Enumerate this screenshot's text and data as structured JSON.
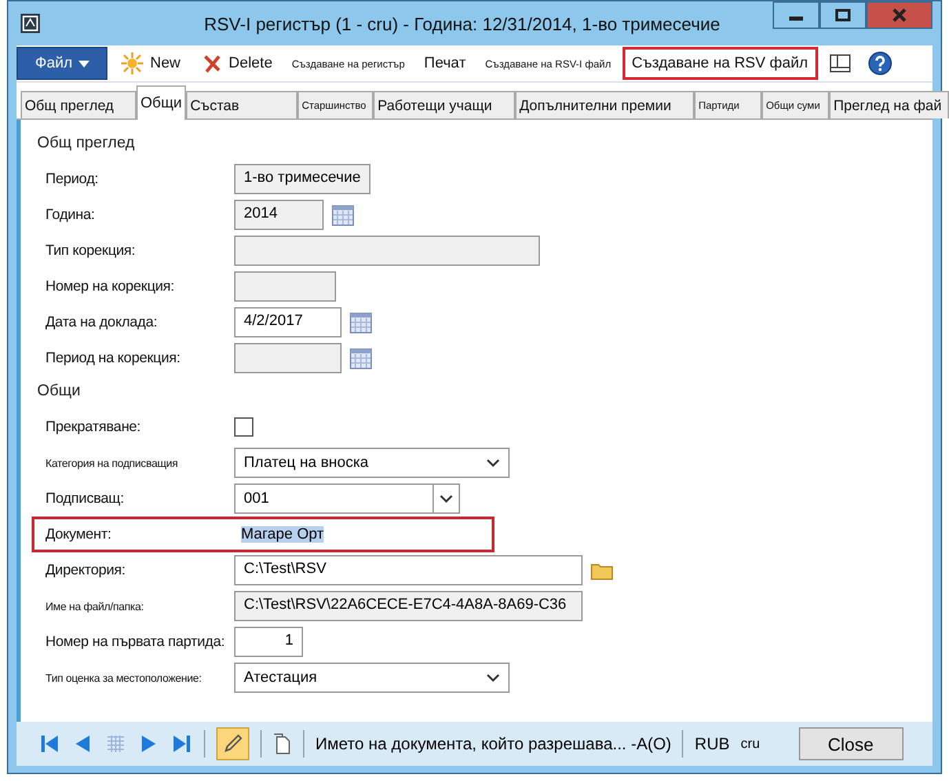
{
  "window": {
    "title": "RSV-I регистър (1 - cru) - Година: 12/31/2014, 1-во тримесечие"
  },
  "toolbar": [
    {
      "kind": "menu",
      "label": "Файл",
      "highlighted": false
    },
    {
      "kind": "new",
      "label": "New",
      "highlighted": false
    },
    {
      "kind": "delete",
      "label": "Delete",
      "highlighted": false
    },
    {
      "kind": "small",
      "label": "Създаване на регистър",
      "highlighted": false
    },
    {
      "kind": "plain",
      "label": "Печат",
      "highlighted": false
    },
    {
      "kind": "small",
      "label": "Създаване на RSV-I файл",
      "highlighted": false
    },
    {
      "kind": "plain",
      "label": "Създаване на RSV файл",
      "highlighted": true
    },
    {
      "kind": "panel",
      "highlighted": false
    },
    {
      "kind": "help",
      "highlighted": false
    }
  ],
  "tabs": [
    {
      "label": "Общ преглед",
      "selected": false
    },
    {
      "label": "Общи",
      "selected": true
    },
    {
      "label": "Състав",
      "selected": false
    },
    {
      "label": "Старшинство",
      "selected": false
    },
    {
      "label": "Работещи учащи",
      "selected": false
    },
    {
      "label": "Допълнителни премии",
      "selected": false
    },
    {
      "label": "Партиди",
      "selected": false
    },
    {
      "label": "Общи суми",
      "selected": false
    },
    {
      "label": "Преглед на фай",
      "selected": false
    }
  ],
  "fields": [
    {
      "kind": "section",
      "label": "Общ преглед"
    },
    {
      "kind": "text",
      "label": "Период:",
      "value": "1-во тримесечие",
      "disabled": true,
      "highlighted": false
    },
    {
      "kind": "date",
      "label": "Година:",
      "value": "2014",
      "disabled": true,
      "highlighted": false
    },
    {
      "kind": "text",
      "label": "Тип корекция:",
      "disabled": true,
      "highlighted": false
    },
    {
      "kind": "text",
      "label": "Номер на корекция:",
      "disabled": true,
      "highlighted": false
    },
    {
      "kind": "date",
      "label": "Дата на доклада:",
      "value": "4/2/2017",
      "disabled": false,
      "highlighted": false
    },
    {
      "kind": "date",
      "label": "Период на корекция:",
      "disabled": true,
      "highlighted": false
    },
    {
      "kind": "section",
      "label": "Общи"
    },
    {
      "kind": "checkbox",
      "label": "Прекратяване:",
      "checked": false
    },
    {
      "kind": "select",
      "label": "Категория на подписващия",
      "value": "Платец на вноска"
    },
    {
      "kind": "combo",
      "label": "Подписващ:",
      "value": "001"
    },
    {
      "kind": "plain",
      "label": "Документ:",
      "value": "Магаре Орт",
      "highlighted": true
    },
    {
      "kind": "folder",
      "label": "Директория:",
      "value": "C:\\Test\\RSV",
      "disabled": false,
      "highlighted": false
    },
    {
      "kind": "text",
      "label": "Име на файл/папка:",
      "value": "C:\\Test\\RSV\\22A6CECE-E7C4-4A8A-8A69-C36",
      "disabled": true,
      "highlighted": false
    },
    {
      "kind": "number",
      "label": "Номер на първата партида:",
      "value": "1",
      "disabled": false,
      "highlighted": false
    },
    {
      "kind": "select",
      "label": "Тип оценка за местоположение:",
      "value": "Атестация"
    }
  ],
  "status_bar": {
    "message": "Името на документа, който разрешава... -A(O)",
    "currency": "RUB",
    "company": "cru",
    "close": "Close",
    "edit_on": true
  }
}
